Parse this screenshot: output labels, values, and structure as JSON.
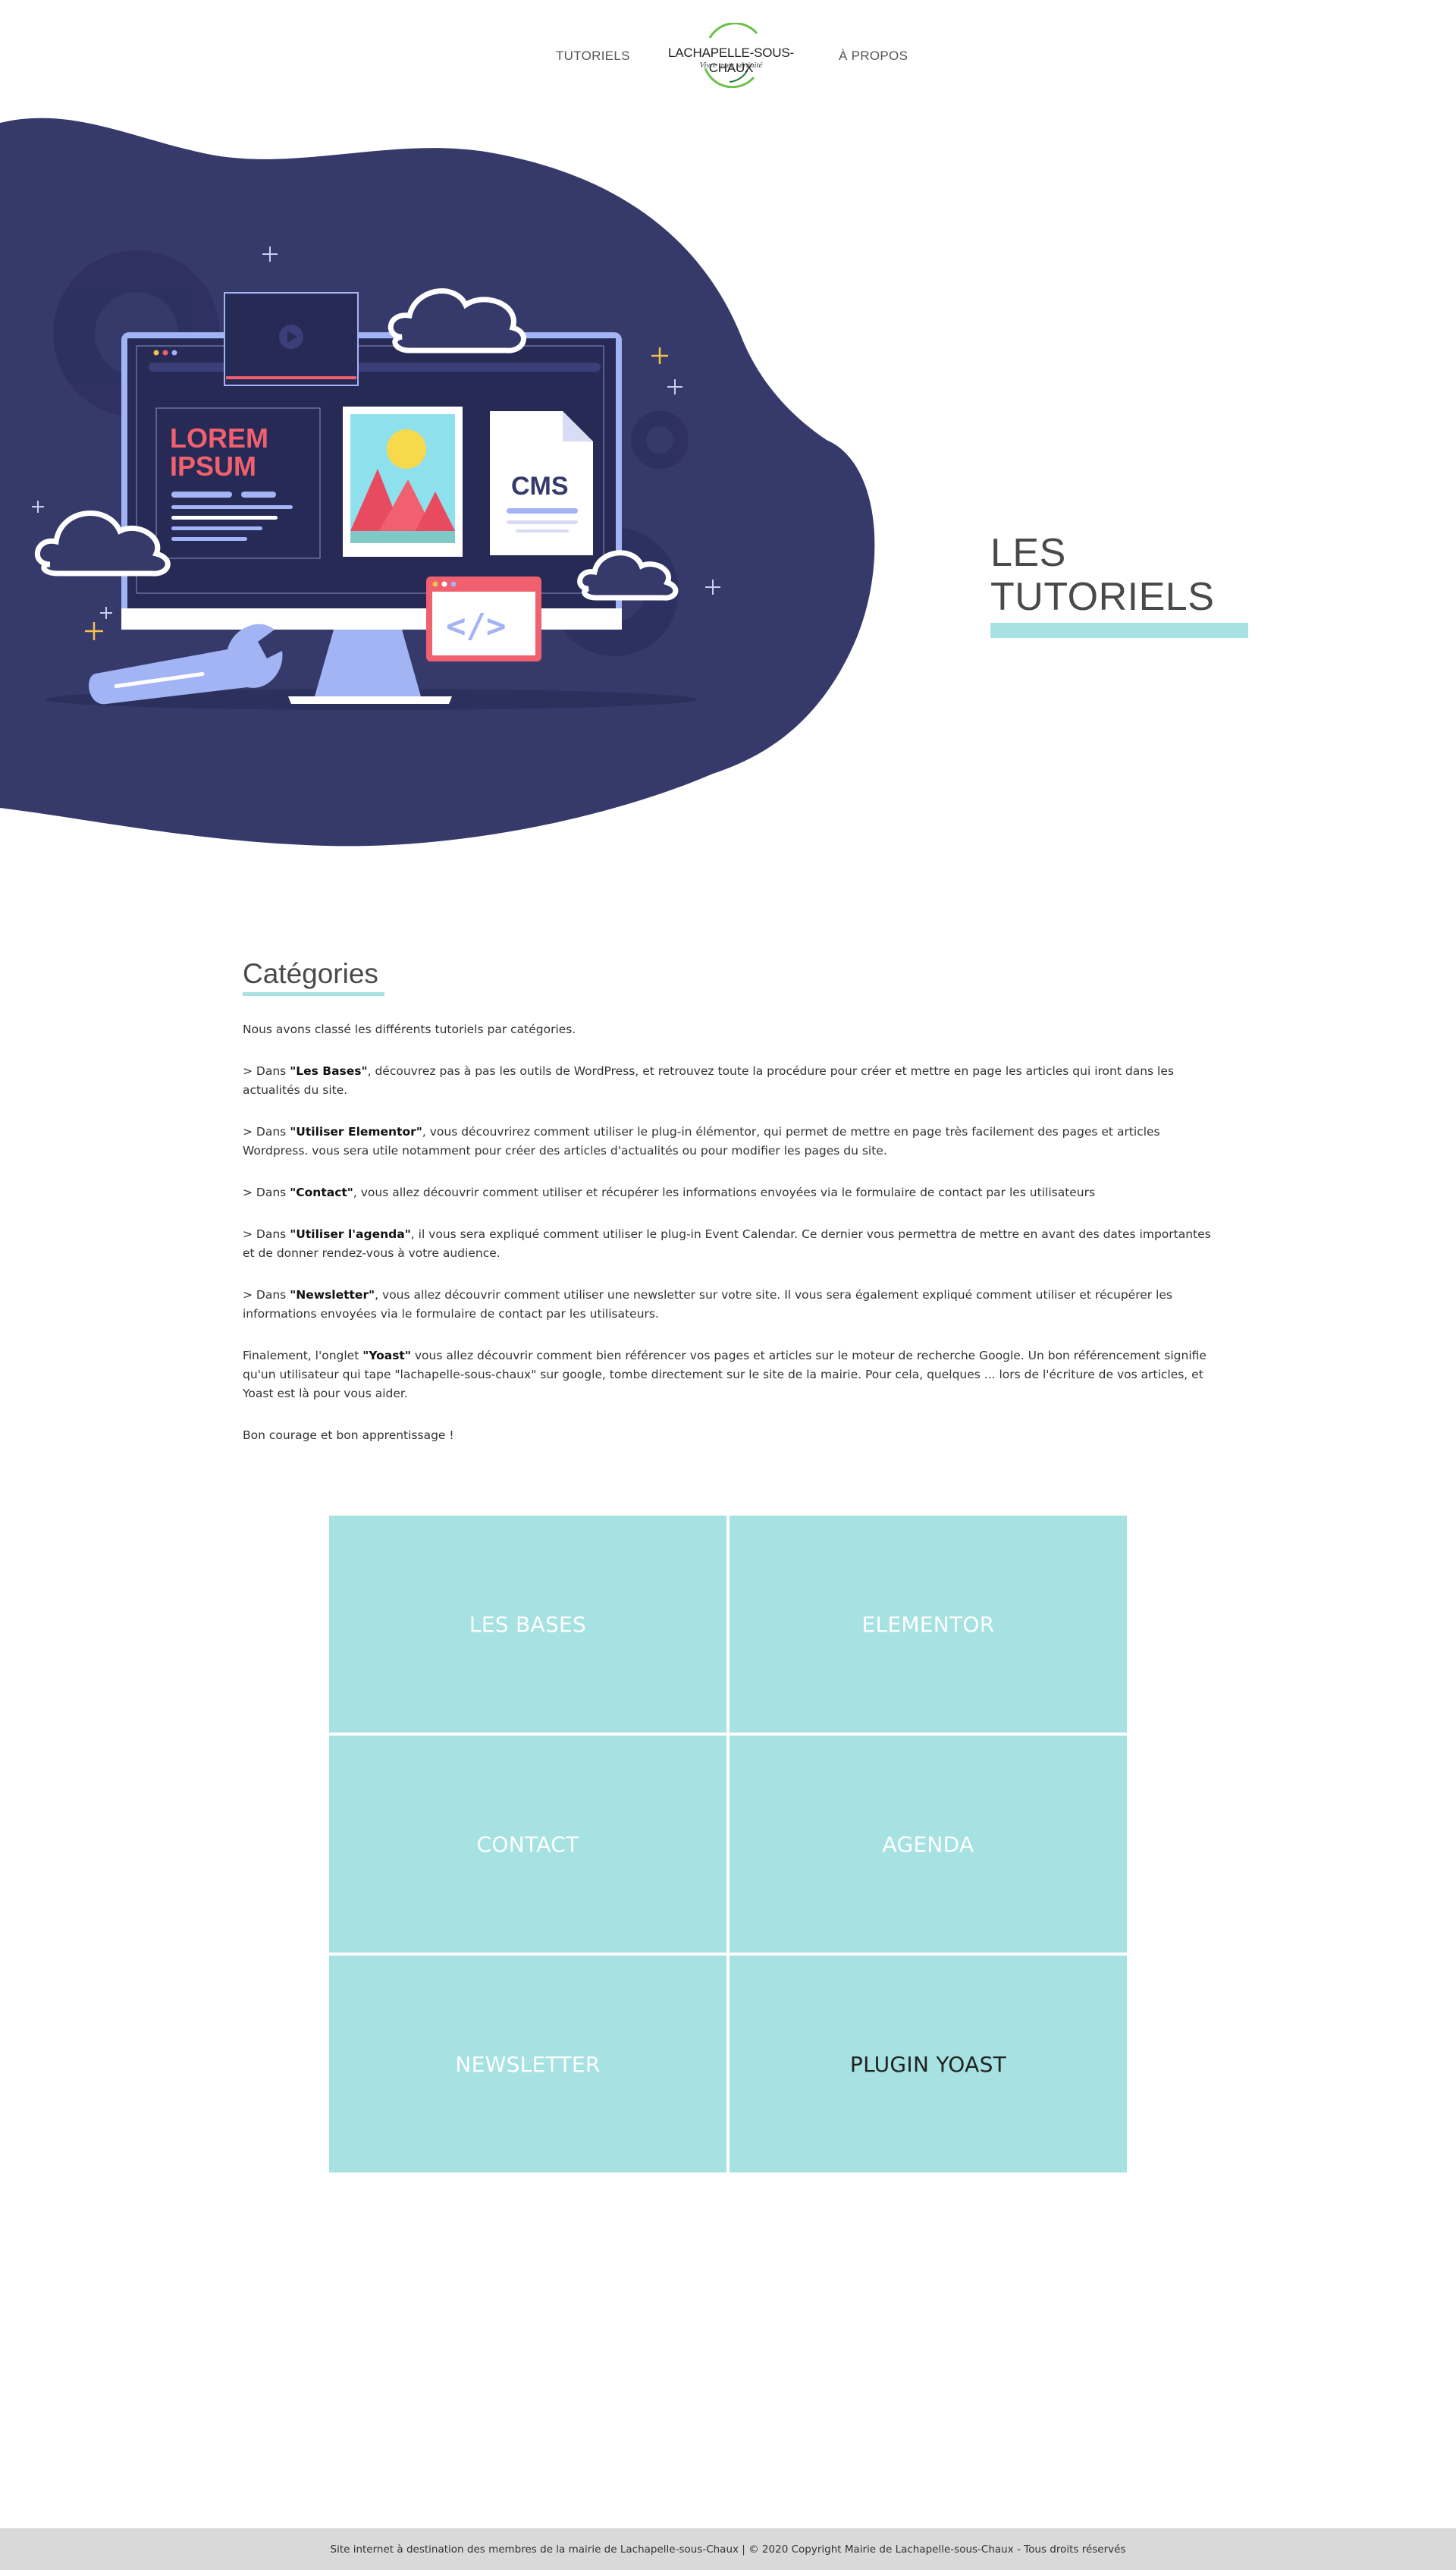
{
  "nav": {
    "left_link": "TUTORIELS",
    "right_link": "À PROPOS",
    "logo_name": "LACHAPELLE-SOUS-CHAUX",
    "logo_tagline": "Vivre avec sérénité",
    "logo_ring_colors": [
      "#6cc04a",
      "#1f7a3a"
    ]
  },
  "hero": {
    "title": "LES TUTORIELS",
    "accent_color": "#a6e2e2",
    "blob_color": "#363a6b",
    "illustration": {
      "window_text_1": "LOREM",
      "window_text_2": "IPSUM",
      "doc_label": "CMS",
      "code_label": "</>"
    }
  },
  "categories": {
    "title": "Catégories",
    "intro": "Nous avons classé les différents tutoriels par catégories.",
    "items": [
      {
        "prefix": "> Dans ",
        "bold": "\"Les Bases\"",
        "text": ", découvrez pas à pas les outils de WordPress, et retrouvez toute la procédure pour créer et mettre en page les articles qui iront dans les actualités du site."
      },
      {
        "prefix": "> Dans ",
        "bold": "\"Utiliser Elementor\"",
        "text": ", vous découvrirez comment utiliser le plug-in élémentor, qui permet de mettre en page très facilement des pages et articles Wordpress. vous sera utile notamment pour créer des articles d'actualités ou pour modifier les pages du site."
      },
      {
        "prefix": "> Dans ",
        "bold": "\"Contact\"",
        "text": ", vous allez découvrir comment utiliser et récupérer les informations envoyées via le formulaire de contact par les utilisateurs"
      },
      {
        "prefix": "> Dans ",
        "bold": "\"Utiliser l'agenda\"",
        "text": ", il vous sera expliqué comment utiliser le plug-in Event Calendar. Ce dernier vous permettra de mettre en avant des dates importantes et de donner rendez-vous à votre audience."
      },
      {
        "prefix": "> Dans ",
        "bold": "\"Newsletter\"",
        "text": ", vous allez découvrir comment utiliser une newsletter sur votre site. Il vous sera également expliqué comment utiliser et récupérer les informations envoyées via le formulaire de contact par les utilisateurs."
      },
      {
        "prefix": "Finalement, l'onglet ",
        "bold": "\"Yoast\"",
        "text": " vous allez découvrir comment bien référencer vos pages et articles sur le moteur de recherche Google. Un bon référencement signifie qu'un utilisateur qui tape \"lachapelle-sous-chaux\" sur google, tombe directement sur le site de la mairie. Pour cela, quelques ... lors de l'écriture de vos articles, et Yoast est là pour vous aider."
      }
    ],
    "closing": "Bon courage et bon apprentissage !"
  },
  "tiles": [
    {
      "label": "LES BASES"
    },
    {
      "label": "ELEMENTOR"
    },
    {
      "label": "CONTACT"
    },
    {
      "label": "AGENDA"
    },
    {
      "label": "NEWSLETTER"
    },
    {
      "label": "PLUGIN YOAST"
    }
  ],
  "footer": {
    "text": "Site internet à destination des membres de la mairie de Lachapelle-sous-Chaux | © 2020 Copyright Mairie de Lachapelle-sous-Chaux - Tous droits réservés"
  }
}
